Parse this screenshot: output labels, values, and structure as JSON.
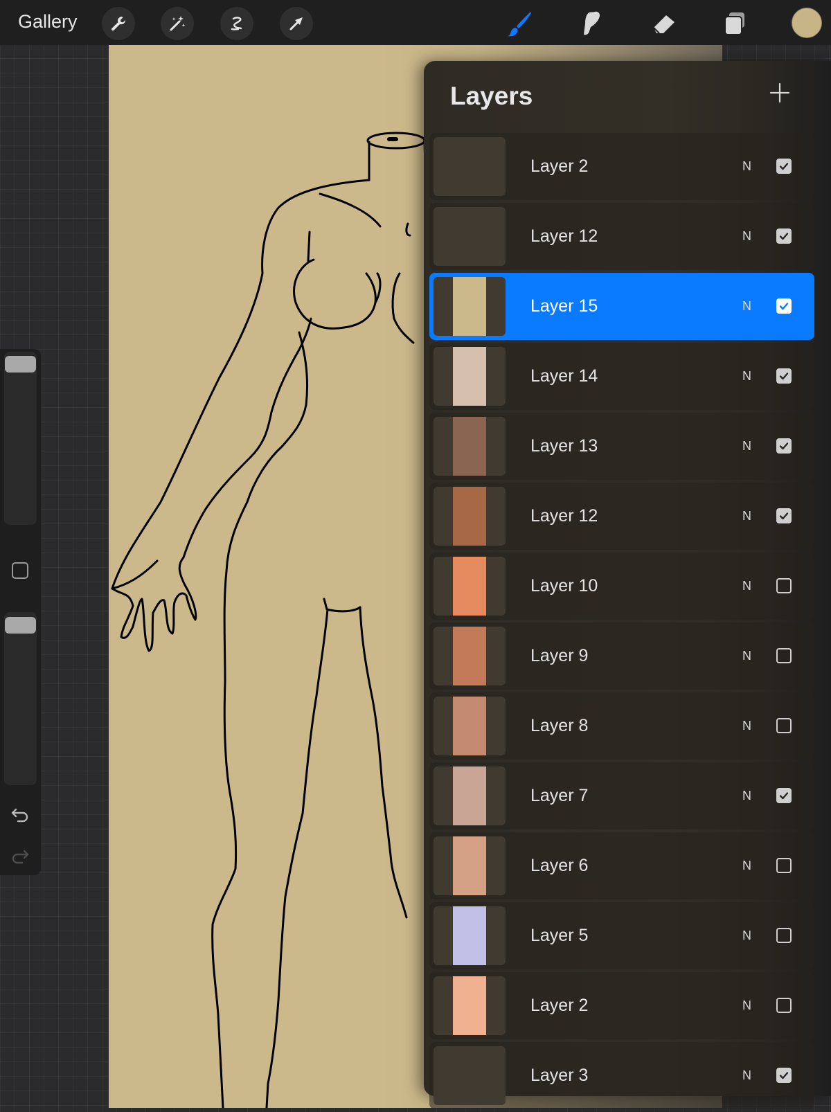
{
  "topbar": {
    "gallery_label": "Gallery",
    "tools_left": [
      "wrench-icon",
      "magic-wand-icon",
      "selection-icon",
      "transform-arrow-icon"
    ],
    "tools_right": [
      "brush-icon",
      "smudge-icon",
      "eraser-icon",
      "layers-icon"
    ],
    "active_tool": "brush-icon",
    "active_tool_color": "#0a7aff",
    "current_color": "#c8b587"
  },
  "sidebar": {
    "items": [
      "brush-size-slider",
      "modify-button",
      "opacity-slider",
      "undo-icon",
      "redo-icon"
    ]
  },
  "layers_panel": {
    "title": "Layers",
    "add_icon": "plus-icon",
    "layers": [
      {
        "name": "Layer 2",
        "blend": "N",
        "visible": true,
        "thumb_color": "#403a31",
        "selected": false
      },
      {
        "name": "Layer 12",
        "blend": "N",
        "visible": true,
        "thumb_color": "#403a31",
        "selected": false
      },
      {
        "name": "Layer 15",
        "blend": "N",
        "visible": true,
        "thumb_color": "#ccb98b",
        "selected": true
      },
      {
        "name": "Layer 14",
        "blend": "N",
        "visible": true,
        "thumb_color": "#d6bfad",
        "selected": false
      },
      {
        "name": "Layer 13",
        "blend": "N",
        "visible": true,
        "thumb_color": "#8a6551",
        "selected": false
      },
      {
        "name": "Layer 12",
        "blend": "N",
        "visible": true,
        "thumb_color": "#a66845",
        "selected": false
      },
      {
        "name": "Layer 10",
        "blend": "N",
        "visible": false,
        "thumb_color": "#e68a5f",
        "selected": false
      },
      {
        "name": "Layer 9",
        "blend": "N",
        "visible": false,
        "thumb_color": "#c27a58",
        "selected": false
      },
      {
        "name": "Layer 8",
        "blend": "N",
        "visible": false,
        "thumb_color": "#c48b70",
        "selected": false
      },
      {
        "name": "Layer 7",
        "blend": "N",
        "visible": true,
        "thumb_color": "#c8a594",
        "selected": false
      },
      {
        "name": "Layer 6",
        "blend": "N",
        "visible": false,
        "thumb_color": "#d4a185",
        "selected": false
      },
      {
        "name": "Layer 5",
        "blend": "N",
        "visible": false,
        "thumb_color": "#c3c0e8",
        "selected": false
      },
      {
        "name": "Layer 2",
        "blend": "N",
        "visible": false,
        "thumb_color": "#efb18f",
        "selected": false
      },
      {
        "name": "Layer 3",
        "blend": "N",
        "visible": true,
        "thumb_color": "#403a31",
        "selected": false
      }
    ]
  },
  "canvas": {
    "background_color": "#ccb98b"
  }
}
